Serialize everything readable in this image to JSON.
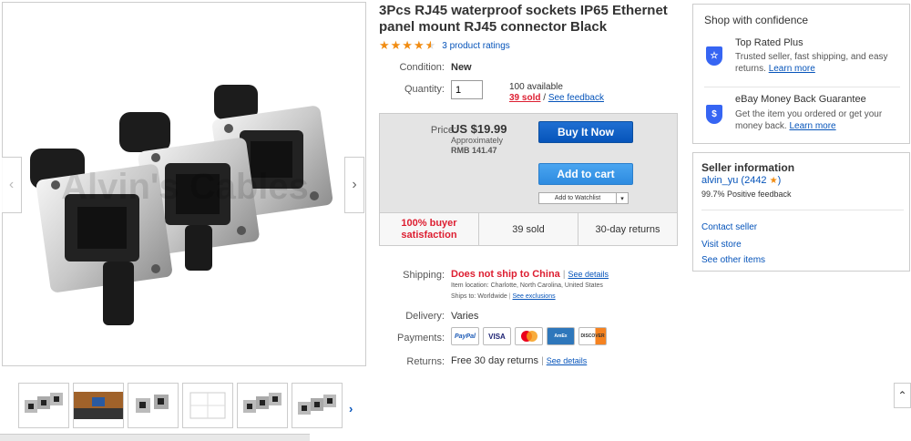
{
  "product": {
    "title": "3Pcs RJ45 waterproof sockets IP65 Ethernet panel mount RJ45 connector Black",
    "rating_stars": "★★★★",
    "rating_half": "★",
    "rating_text": "3 product ratings",
    "rating_value": 4.5
  },
  "gallery": {
    "watermark": "Alvin's Cables",
    "thumb_count": 6
  },
  "details": {
    "condition_label": "Condition:",
    "condition_value": "New",
    "quantity_label": "Quantity:",
    "quantity_value": "1",
    "available": "100 available",
    "sold_link": "39 sold",
    "slash": " / ",
    "feedback_link": "See feedback"
  },
  "price": {
    "label": "Price:",
    "value": "US $19.99",
    "approx": "Approximately",
    "rmb": "RMB 141.47",
    "buy_now": "Buy It Now",
    "add_cart": "Add to cart",
    "watchlist": "Add to Watchlist",
    "watch_arrow": "▾"
  },
  "stats": {
    "satisfaction": "100% buyer satisfaction",
    "sold": "39 sold",
    "returns": "30-day returns"
  },
  "shipping": {
    "label": "Shipping:",
    "value": "Does not ship to China",
    "see_details": "See details",
    "item_location": "Item location:  Charlotte, North Carolina, United States",
    "ships_to_label": "Ships to:",
    "ships_to_value": "Worldwide",
    "see_exclusions": "See exclusions",
    "separator": "|"
  },
  "delivery": {
    "label": "Delivery:",
    "value": "Varies"
  },
  "payments": {
    "label": "Payments:",
    "methods": [
      "PayPal",
      "VISA",
      "MasterCard",
      "AmEx",
      "DISCOVER"
    ]
  },
  "returns": {
    "label": "Returns:",
    "value": "Free 30 day returns",
    "see_details": "See details"
  },
  "confidence": {
    "title": "Shop with confidence",
    "top_rated_title": "Top Rated Plus",
    "top_rated_text": "Trusted seller, fast shipping, and easy returns.",
    "learn_more_1": "Learn more",
    "guarantee_title": "eBay Money Back Guarantee",
    "guarantee_text": "Get the item you ordered or get your money back.",
    "learn_more_2": "Learn more"
  },
  "seller": {
    "title": "Seller information",
    "name": "alvin_yu",
    "score": " (2442",
    "score_close": ")",
    "feedback": "99.7% Positive feedback",
    "contact": "Contact seller",
    "visit": "Visit store",
    "other_items": "See other items"
  },
  "colors": {
    "link": "#0654ba",
    "alert_red": "#dd1e31",
    "buy_now": "#0654ba",
    "add_cart": "#2d8be0",
    "star": "#f18c12"
  }
}
